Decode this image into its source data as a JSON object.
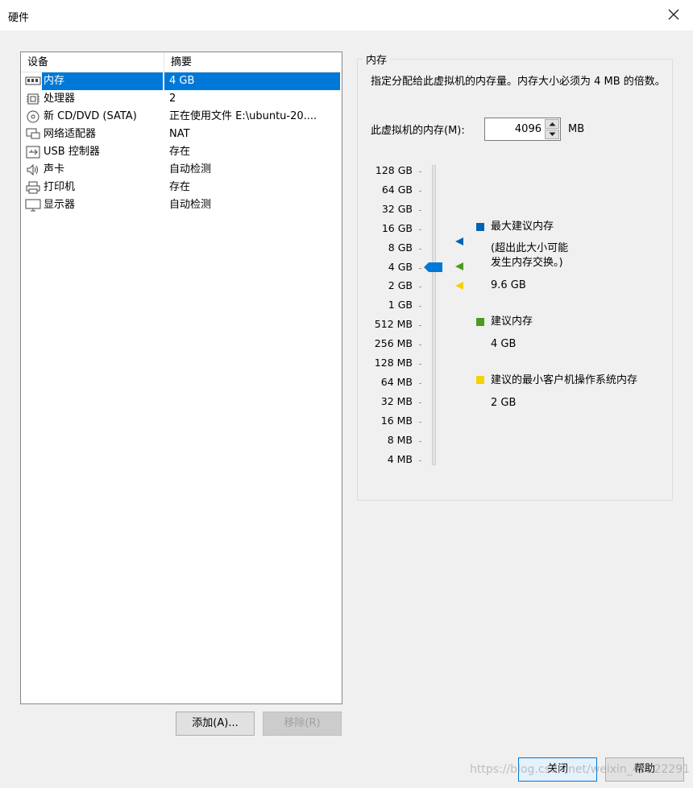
{
  "window": {
    "title": "硬件"
  },
  "devices": {
    "headers": {
      "device": "设备",
      "summary": "摘要"
    },
    "items": [
      {
        "icon": "memory-icon",
        "name": "内存",
        "summary": "4 GB",
        "selected": true
      },
      {
        "icon": "processor-icon",
        "name": "处理器",
        "summary": "2",
        "selected": false
      },
      {
        "icon": "cd-dvd-icon",
        "name": "新 CD/DVD (SATA)",
        "summary": "正在使用文件 E:\\ubuntu-20....",
        "selected": false
      },
      {
        "icon": "network-adapter-icon",
        "name": "网络适配器",
        "summary": "NAT",
        "selected": false
      },
      {
        "icon": "usb-icon",
        "name": "USB 控制器",
        "summary": "存在",
        "selected": false
      },
      {
        "icon": "sound-icon",
        "name": "声卡",
        "summary": "自动检测",
        "selected": false
      },
      {
        "icon": "printer-icon",
        "name": "打印机",
        "summary": "存在",
        "selected": false
      },
      {
        "icon": "display-icon",
        "name": "显示器",
        "summary": "自动检测",
        "selected": false
      }
    ],
    "add_label": "添加(A)...",
    "remove_label": "移除(R)"
  },
  "memory": {
    "group_title": "内存",
    "description": "指定分配给此虚拟机的内存量。内存大小必须为 4 MB 的倍数。",
    "input_label": "此虚拟机的内存(M):",
    "value": "4096",
    "unit": "MB",
    "scale": [
      "128 GB",
      "64 GB",
      "32 GB",
      "16 GB",
      "8 GB",
      "4 GB",
      "2 GB",
      "1 GB",
      "512 MB",
      "256 MB",
      "128 MB",
      "64 MB",
      "32 MB",
      "16 MB",
      "8 MB",
      "4 MB"
    ],
    "legend": {
      "max_label": "最大建议内存",
      "max_note": "(超出此大小可能\n发生内存交换。)",
      "max_value": "9.6 GB",
      "rec_label": "建议内存",
      "rec_value": "4 GB",
      "min_label": "建议的最小客户机操作系统内存",
      "min_value": "2 GB"
    },
    "colors": {
      "max": "#0063b1",
      "rec": "#4c9a1f",
      "min": "#f2d300",
      "thumb": "#0078d7"
    }
  },
  "footer": {
    "close_label": "关闭",
    "help_label": "帮助"
  },
  "watermark": "https://blog.csdn.net/weixin_45222291"
}
